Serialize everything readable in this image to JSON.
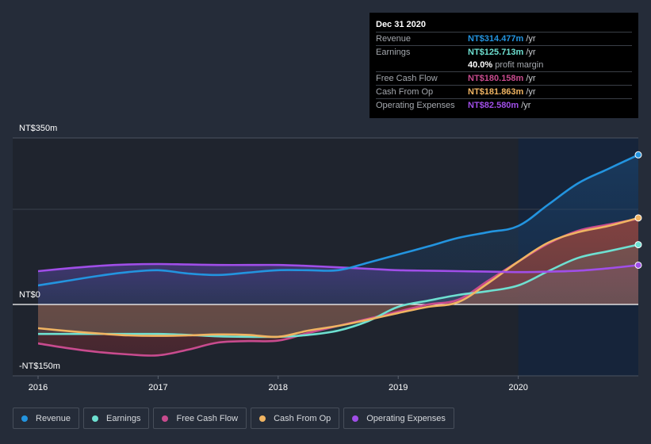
{
  "tooltip": {
    "title": "Dec 31 2020",
    "rows": [
      {
        "label": "Revenue",
        "value": "NT$314.477m",
        "unit": "/yr",
        "color": "#2394df"
      },
      {
        "label": "Earnings",
        "value": "NT$125.713m",
        "unit": "/yr",
        "color": "#6ee0d1"
      },
      {
        "label": "",
        "value": "40.0%",
        "unit": "profit margin",
        "color": "#ffffff"
      },
      {
        "label": "Free Cash Flow",
        "value": "NT$180.158m",
        "unit": "/yr",
        "color": "#c84b8e"
      },
      {
        "label": "Cash From Op",
        "value": "NT$181.863m",
        "unit": "/yr",
        "color": "#f0b462"
      },
      {
        "label": "Operating Expenses",
        "value": "NT$82.580m",
        "unit": "/yr",
        "color": "#a04ee8"
      }
    ]
  },
  "legend": [
    {
      "label": "Revenue",
      "color": "#2394df"
    },
    {
      "label": "Earnings",
      "color": "#6ee0d1"
    },
    {
      "label": "Free Cash Flow",
      "color": "#c84b8e"
    },
    {
      "label": "Cash From Op",
      "color": "#f0b462"
    },
    {
      "label": "Operating Expenses",
      "color": "#a04ee8"
    }
  ],
  "chart_data": {
    "type": "line",
    "title": "",
    "xlabel": "",
    "ylabel": "",
    "ylim": [
      -150,
      350
    ],
    "xlim": [
      2016.0,
      2021.0
    ],
    "y_ticks": [
      {
        "value": 350,
        "label": "NT$350m"
      },
      {
        "value": 0,
        "label": "NT$0"
      },
      {
        "value": -150,
        "label": "-NT$150m"
      }
    ],
    "x_ticks": [
      {
        "value": 2016,
        "label": "2016"
      },
      {
        "value": 2017,
        "label": "2017"
      },
      {
        "value": 2018,
        "label": "2018"
      },
      {
        "value": 2019,
        "label": "2019"
      },
      {
        "value": 2020,
        "label": "2020"
      }
    ],
    "highlight_start": 2020.0,
    "grid": true,
    "legend_position": "bottom-left",
    "series": [
      {
        "name": "Revenue",
        "color": "#2394df",
        "x": [
          2016.0,
          2016.25,
          2016.5,
          2016.75,
          2017.0,
          2017.25,
          2017.5,
          2017.75,
          2018.0,
          2018.25,
          2018.5,
          2018.75,
          2019.0,
          2019.25,
          2019.5,
          2019.75,
          2020.0,
          2020.25,
          2020.5,
          2020.75,
          2021.0
        ],
        "values": [
          40,
          50,
          60,
          68,
          72,
          65,
          62,
          67,
          72,
          72,
          72,
          88,
          105,
          122,
          140,
          152,
          165,
          210,
          255,
          285,
          314.5
        ]
      },
      {
        "name": "Earnings",
        "color": "#6ee0d1",
        "x": [
          2016.0,
          2016.25,
          2016.5,
          2016.75,
          2017.0,
          2017.25,
          2017.5,
          2017.75,
          2018.0,
          2018.25,
          2018.5,
          2018.75,
          2019.0,
          2019.25,
          2019.5,
          2019.75,
          2020.0,
          2020.25,
          2020.5,
          2020.75,
          2021.0
        ],
        "values": [
          -62,
          -62,
          -62,
          -62,
          -62,
          -64,
          -67,
          -68,
          -68,
          -64,
          -55,
          -35,
          -5,
          8,
          20,
          28,
          40,
          70,
          98,
          112,
          125.7
        ]
      },
      {
        "name": "Free Cash Flow",
        "color": "#c84b8e",
        "x": [
          2016.0,
          2016.25,
          2016.5,
          2016.75,
          2017.0,
          2017.25,
          2017.5,
          2017.75,
          2018.0,
          2018.25,
          2018.5,
          2018.75,
          2019.0,
          2019.25,
          2019.5,
          2019.75,
          2020.0,
          2020.25,
          2020.5,
          2020.75,
          2021.0
        ],
        "values": [
          -82,
          -92,
          -100,
          -105,
          -107,
          -95,
          -80,
          -77,
          -76,
          -60,
          -45,
          -30,
          -15,
          0,
          10,
          50,
          90,
          128,
          155,
          168,
          180.2
        ]
      },
      {
        "name": "Cash From Op",
        "color": "#f0b462",
        "x": [
          2016.0,
          2016.25,
          2016.5,
          2016.75,
          2017.0,
          2017.25,
          2017.5,
          2017.75,
          2018.0,
          2018.25,
          2018.5,
          2018.75,
          2019.0,
          2019.25,
          2019.5,
          2019.75,
          2020.0,
          2020.25,
          2020.5,
          2020.75,
          2021.0
        ],
        "values": [
          -50,
          -56,
          -61,
          -65,
          -66,
          -65,
          -63,
          -64,
          -68,
          -55,
          -45,
          -32,
          -18,
          -5,
          5,
          45,
          90,
          130,
          152,
          165,
          181.9
        ]
      },
      {
        "name": "Operating Expenses",
        "color": "#a04ee8",
        "x": [
          2016.0,
          2016.25,
          2016.5,
          2016.75,
          2017.0,
          2017.25,
          2017.5,
          2017.75,
          2018.0,
          2018.25,
          2018.5,
          2018.75,
          2019.0,
          2019.25,
          2019.5,
          2019.75,
          2020.0,
          2020.25,
          2020.5,
          2020.75,
          2021.0
        ],
        "values": [
          70,
          76,
          81,
          84,
          85,
          84,
          83,
          83,
          83,
          81,
          78,
          75,
          72,
          71,
          70,
          69,
          68,
          69,
          71,
          76,
          82.6
        ]
      }
    ]
  }
}
